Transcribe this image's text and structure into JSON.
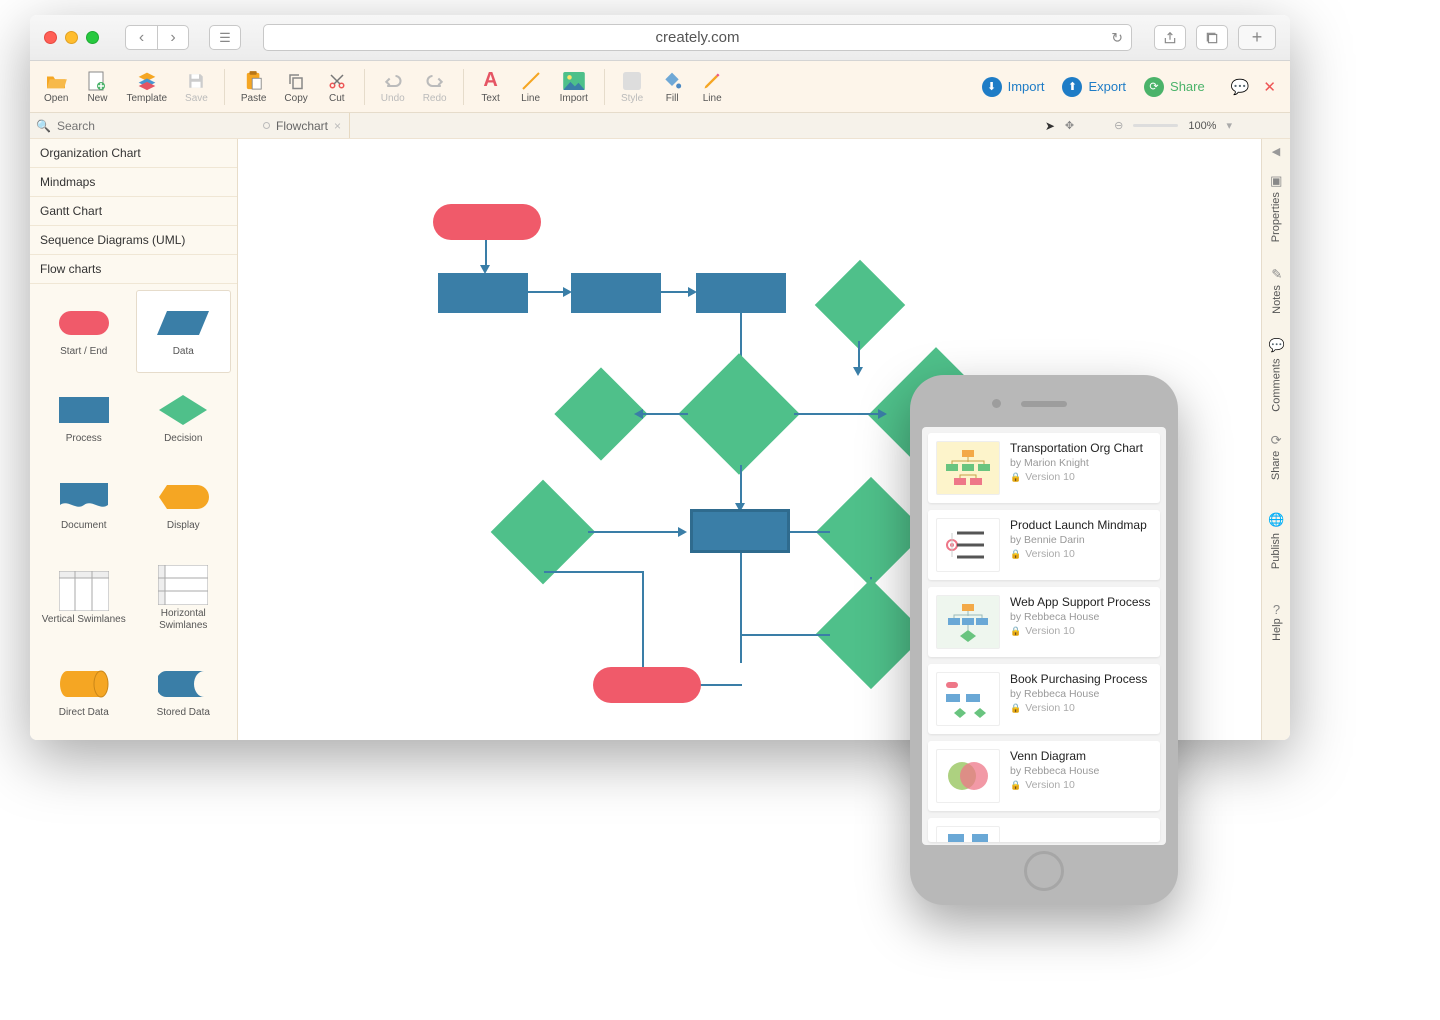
{
  "browser": {
    "url": "creately.com"
  },
  "toolbar": {
    "open": "Open",
    "new": "New",
    "template": "Template",
    "save": "Save",
    "paste": "Paste",
    "copy": "Copy",
    "cut": "Cut",
    "undo": "Undo",
    "redo": "Redo",
    "text": "Text",
    "line": "Line",
    "import_img": "Import",
    "style": "Style",
    "fill": "Fill",
    "line_style": "Line",
    "import_btn": "Import",
    "export_btn": "Export",
    "share_btn": "Share"
  },
  "tab": {
    "name": "Flowchart"
  },
  "zoom": {
    "value": "100%"
  },
  "search": {
    "placeholder": "Search"
  },
  "categories": [
    "Organization Chart",
    "Mindmaps",
    "Gantt Chart",
    "Sequence Diagrams (UML)",
    "Flow charts"
  ],
  "shapes": {
    "start_end": "Start / End",
    "data": "Data",
    "process": "Process",
    "decision": "Decision",
    "document": "Document",
    "display": "Display",
    "vert_swim": "Vertical Swimlanes",
    "horiz_swim": "Horizontal Swimlanes",
    "direct_data": "Direct Data",
    "stored_data": "Stored Data"
  },
  "right_rail": {
    "properties": "Properties",
    "notes": "Notes",
    "comments": "Comments",
    "share": "Share",
    "publish": "Publish",
    "help": "Help"
  },
  "phone_cards": [
    {
      "title": "Transportation Org Chart",
      "author": "by Marion Knight",
      "version": "Version 10"
    },
    {
      "title": "Product Launch Mindmap",
      "author": "by Bennie Darin",
      "version": "Version 10"
    },
    {
      "title": "Web App Support Process",
      "author": "by Rebbeca House",
      "version": "Version 10"
    },
    {
      "title": "Book Purchasing Process",
      "author": "by Rebbeca House",
      "version": "Version 10"
    },
    {
      "title": "Venn Diagram",
      "author": "by Rebbeca House",
      "version": "Version 10"
    }
  ]
}
